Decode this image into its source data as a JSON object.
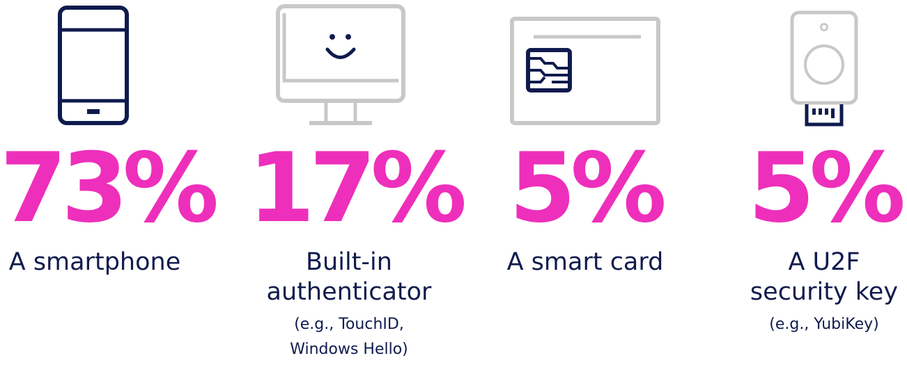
{
  "colors": {
    "accent": "#ee2fbb",
    "navy": "#0f1b4d",
    "gray": "#c8c8c8"
  },
  "items": [
    {
      "icon": "smartphone-icon",
      "percent": "73%",
      "label_lines": [
        "A smartphone"
      ],
      "note_lines": []
    },
    {
      "icon": "monitor-smiley-icon",
      "percent": "17%",
      "label_lines": [
        "Built-in",
        "authenticator"
      ],
      "note_lines": [
        "(e.g., TouchID,",
        "Windows Hello)"
      ]
    },
    {
      "icon": "smart-card-icon",
      "percent": "5%",
      "label_lines": [
        "A smart card"
      ],
      "note_lines": []
    },
    {
      "icon": "security-key-icon",
      "percent": "5%",
      "label_lines": [
        "A U2F",
        "security key"
      ],
      "note_lines": [
        "(e.g., YubiKey)"
      ]
    }
  ]
}
